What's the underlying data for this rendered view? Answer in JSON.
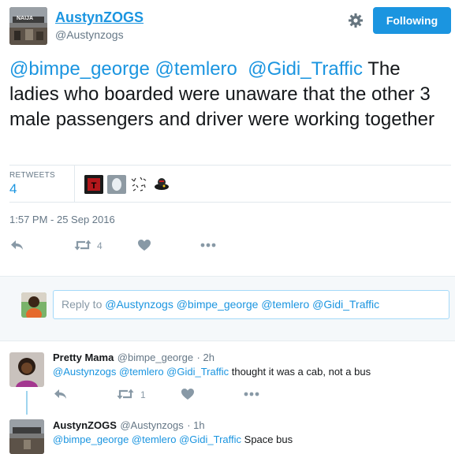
{
  "author": {
    "display_name": "AustynZOGS",
    "screen_name": "@Austynzogs",
    "avatar_caption": "NAIJA"
  },
  "header": {
    "follow_label": "Following",
    "settings_icon": "gear-icon"
  },
  "tweet": {
    "mentions": [
      "@bimpe_george",
      "@temlero",
      "@Gidi_Traffic"
    ],
    "body": "The ladies who boarded were unaware that the other 3 male passengers and driver were working together",
    "retweets_label": "RETWEETS",
    "retweets_count": "4",
    "timestamp": "1:57 PM - 25 Sep 2016",
    "retweet_action_count": "4"
  },
  "reply_box": {
    "prefix": "Reply to",
    "mentions": "@Austynzogs @bimpe_george @temlero @Gidi_Traffic"
  },
  "replies": [
    {
      "name": "Pretty Mama",
      "handle": "@bimpe_george",
      "time": "· 2h",
      "mentions": "@Austynzogs @temlero @Gidi_Traffic",
      "text": "thought it was a cab, not a bus",
      "retweet_count": "1"
    },
    {
      "name": "AustynZOGS",
      "handle": "@Austynzogs",
      "time": "· 1h",
      "mentions": "@bimpe_george @temlero @Gidi_Traffic",
      "text": "Space bus"
    }
  ],
  "colors": {
    "accent": "#1b95e0",
    "muted": "#657786",
    "icon": "#8899a6",
    "reply_bg": "#f5f8fa"
  }
}
